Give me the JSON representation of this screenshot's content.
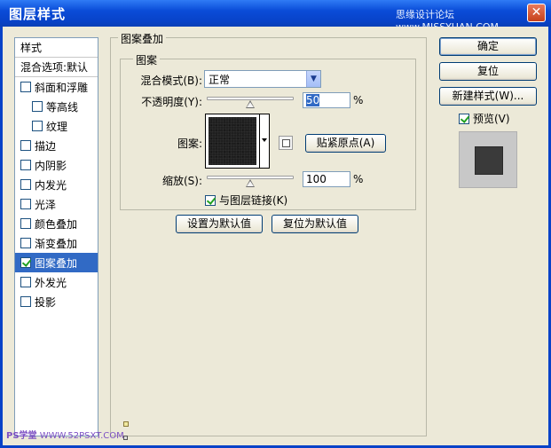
{
  "window": {
    "title": "图层样式",
    "watermark": "思缘设计论坛 www.MISSYUAN.COM",
    "close_symbol": "✕"
  },
  "style_list": {
    "header": "样式",
    "blend_options": "混合选项:默认",
    "items": [
      {
        "label": "斜面和浮雕",
        "checked": false,
        "indent": false,
        "selected": false
      },
      {
        "label": "等高线",
        "checked": false,
        "indent": true,
        "selected": false
      },
      {
        "label": "纹理",
        "checked": false,
        "indent": true,
        "selected": false
      },
      {
        "label": "描边",
        "checked": false,
        "indent": false,
        "selected": false
      },
      {
        "label": "内阴影",
        "checked": false,
        "indent": false,
        "selected": false
      },
      {
        "label": "内发光",
        "checked": false,
        "indent": false,
        "selected": false
      },
      {
        "label": "光泽",
        "checked": false,
        "indent": false,
        "selected": false
      },
      {
        "label": "颜色叠加",
        "checked": false,
        "indent": false,
        "selected": false
      },
      {
        "label": "渐变叠加",
        "checked": false,
        "indent": false,
        "selected": false
      },
      {
        "label": "图案叠加",
        "checked": true,
        "indent": false,
        "selected": true
      },
      {
        "label": "外发光",
        "checked": false,
        "indent": false,
        "selected": false
      },
      {
        "label": "投影",
        "checked": false,
        "indent": false,
        "selected": false
      }
    ]
  },
  "pattern_overlay": {
    "group_title": "图案叠加",
    "sub_group_title": "图案",
    "blend_mode_label": "混合模式(B):",
    "blend_mode_value": "正常",
    "opacity_label": "不透明度(Y):",
    "opacity_value": "50",
    "opacity_level": 0.5,
    "opacity_unit": "%",
    "pattern_label": "图案:",
    "snap_origin_button": "贴紧原点(A)",
    "scale_label": "缩放(S):",
    "scale_value": "100",
    "scale_level": 0.5,
    "scale_unit": "%",
    "link_with_layer_label": "与图层链接(K)",
    "link_with_layer_checked": true,
    "set_default_button": "设置为默认值",
    "reset_default_button": "复位为默认值"
  },
  "actions": {
    "ok_label": "确定",
    "reset_label": "复位",
    "new_style_label": "新建样式(W)...",
    "preview_label": "预览(V)",
    "preview_checked": true
  },
  "footer": {
    "ps_label": "PS学堂",
    "site": "WWW.52PSXT.COM"
  }
}
